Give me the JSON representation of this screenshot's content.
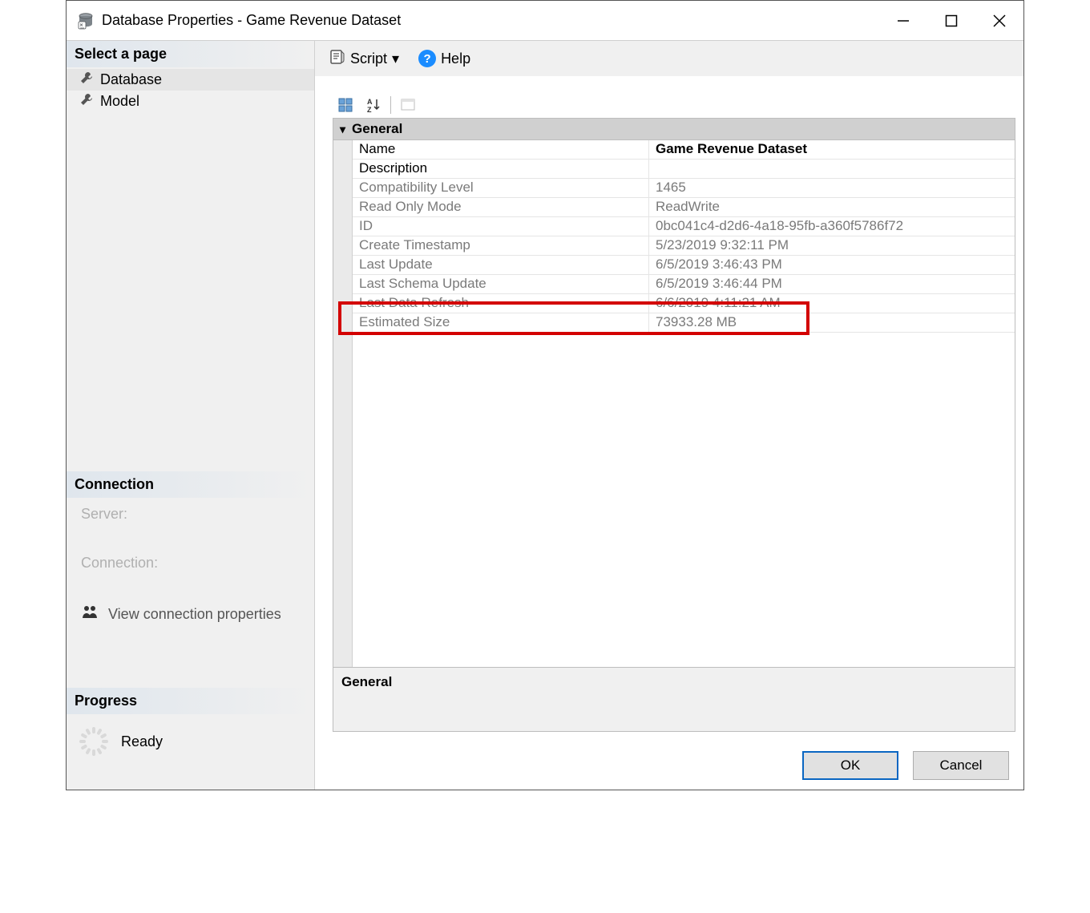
{
  "title": "Database Properties - Game Revenue Dataset",
  "sidebar": {
    "select_page": "Select a page",
    "pages": {
      "database": "Database",
      "model": "Model"
    },
    "connection_header": "Connection",
    "server_label": "Server:",
    "connection_label": "Connection:",
    "view_connection_properties": "View connection properties",
    "progress_header": "Progress",
    "progress_status": "Ready"
  },
  "toolbar": {
    "script_label": "Script",
    "help_label": "Help"
  },
  "grid": {
    "group_label": "General",
    "rows": {
      "name": {
        "label": "Name",
        "value": "Game Revenue Dataset"
      },
      "description": {
        "label": "Description",
        "value": ""
      },
      "compatibility": {
        "label": "Compatibility Level",
        "value": "1465"
      },
      "read_only": {
        "label": "Read Only Mode",
        "value": "ReadWrite"
      },
      "id": {
        "label": "ID",
        "value": "0bc041c4-d2d6-4a18-95fb-a360f5786f72"
      },
      "create_ts": {
        "label": "Create Timestamp",
        "value": "5/23/2019 9:32:11 PM"
      },
      "last_update": {
        "label": "Last Update",
        "value": "6/5/2019 3:46:43 PM"
      },
      "last_schema": {
        "label": "Last Schema Update",
        "value": "6/5/2019 3:46:44 PM"
      },
      "last_refresh": {
        "label": "Last Data Refresh",
        "value": "6/6/2019 4:11:21 AM"
      },
      "est_size": {
        "label": "Estimated Size",
        "value": "73933.28 MB"
      }
    },
    "description_panel": "General"
  },
  "footer": {
    "ok": "OK",
    "cancel": "Cancel"
  }
}
